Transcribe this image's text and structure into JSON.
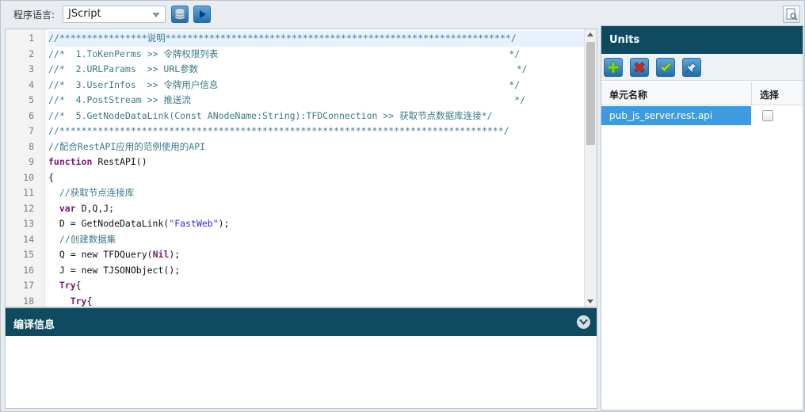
{
  "toolbar": {
    "language_label": "程序语言:",
    "language_value": "JScript"
  },
  "editor": {
    "lines": [
      {
        "num": "1",
        "text": "//****************说明***************************************************************/",
        "cls": "c"
      },
      {
        "num": "2",
        "text": "//*  1.ToKenPerms >> 令牌权限列表                                                     */",
        "cls": "c"
      },
      {
        "num": "3",
        "text": "//*  2.URLParams  >> URL参数                                                          */",
        "cls": "c"
      },
      {
        "num": "4",
        "text": "//*  3.UserInfos  >> 令牌用户信息                                                     */",
        "cls": "c"
      },
      {
        "num": "5",
        "text": "//*  4.PostStream >> 推送流                                                           */",
        "cls": "c"
      },
      {
        "num": "6",
        "text": "//*  5.GetNodeDataLink(Const ANodeName:String):TFDConnection >> 获取节点数据库连接*/",
        "cls": "c"
      },
      {
        "num": "7",
        "text": "//*********************************************************************************/",
        "cls": "c"
      },
      {
        "num": "8",
        "text": "//配合RestAPI应用的范例使用的API",
        "cls": "c"
      },
      {
        "num": "9",
        "kw": "function",
        "rest": " RestAPI()"
      },
      {
        "num": "10",
        "text": "{",
        "cls": ""
      },
      {
        "num": "11",
        "text": "  //获取节点连接库",
        "cls": "c"
      },
      {
        "num": "12",
        "indent": "  ",
        "kw": "var",
        "rest": " D,Q,J;"
      },
      {
        "num": "13",
        "pre": "  D = GetNodeDataLink(",
        "str": "\"FastWeb\"",
        "post": ");"
      },
      {
        "num": "14",
        "text": "  //创建数据集",
        "cls": "c"
      },
      {
        "num": "15",
        "pre": "  Q = new TFDQuery(",
        "kw2": "Nil",
        "post": ");"
      },
      {
        "num": "16",
        "text": "  J = new TJSONObject();",
        "cls": ""
      },
      {
        "num": "17",
        "indent": "  ",
        "kw": "Try",
        "rest": "{"
      },
      {
        "num": "18",
        "indent": "    ",
        "kw": "Try",
        "rest": "{"
      }
    ]
  },
  "compile": {
    "title": "编译信息"
  },
  "units": {
    "title": "Units",
    "col_name": "单元名称",
    "col_select": "选择",
    "rows": [
      {
        "name": "pub_js_server.rest.api",
        "selected": false
      }
    ]
  },
  "colors": {
    "header_bg": "#0e4b61",
    "selected_row": "#3d9be1",
    "comment": "#3c7a8a",
    "keyword": "#7a1b6e",
    "string": "#2b2be0"
  }
}
